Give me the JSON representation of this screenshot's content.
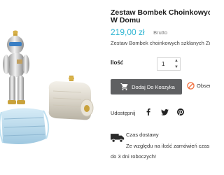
{
  "product": {
    "title_line1": "Zestaw Bombek Choinkowych",
    "title_line2": "W Domu",
    "price": "219,00 zł",
    "tax_label": "Brutto",
    "short_description": "Zestaw Bombek choinkowych szklanych Zo"
  },
  "quantity": {
    "label": "Ilość",
    "value": "1"
  },
  "actions": {
    "add_to_cart": "Dodaj Do Koszyka",
    "observe": "Obserwuj"
  },
  "share": {
    "label": "Udostępnij",
    "icons": [
      "facebook-icon",
      "twitter-icon",
      "pinterest-icon"
    ]
  },
  "delivery": {
    "title": "Czas dostawy",
    "text_line1": "Ze względu na ilość zamówień czas w",
    "text_line2": "do 3 dni roboczych!"
  },
  "colors": {
    "price": "#2fb5d2",
    "button": "#5f6062",
    "observe_icon": "#f26b38"
  }
}
